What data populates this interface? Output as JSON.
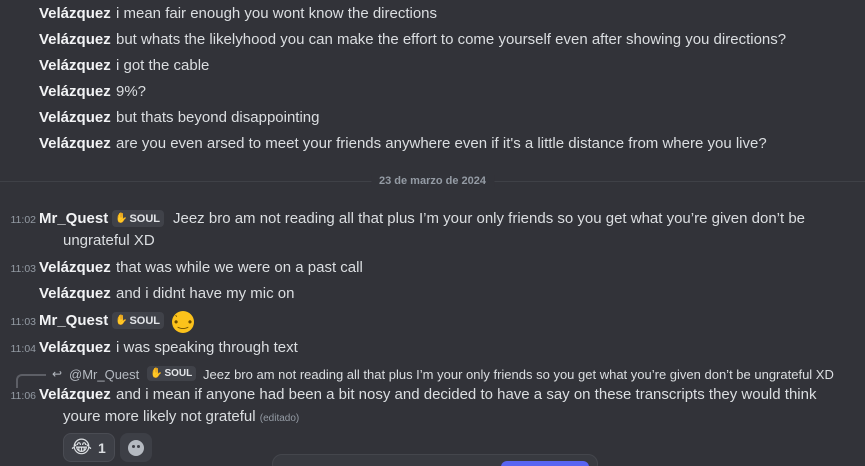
{
  "messages_top": [
    {
      "author": "Velázquez",
      "text": "i mean fair enough you wont know the directions"
    },
    {
      "author": "Velázquez",
      "text": "but whats the likelyhood you can make the effort to come yourself even after showing you directions?"
    },
    {
      "author": "Velázquez",
      "text": "i got the cable"
    },
    {
      "author": "Velázquez",
      "text": "9%?"
    },
    {
      "author": "Velázquez",
      "text": "but thats beyond disappointing"
    },
    {
      "author": "Velázquez",
      "text": "are you even arsed to meet your friends anywhere even if it's a little distance from where you live?"
    }
  ],
  "date_divider": "23 de marzo de 2024",
  "msg1": {
    "time": "11:02",
    "author": "Mr_Quest",
    "badge": "SOUL",
    "text_line1": "Jeez bro am not reading all that plus I’m your only friends so you get what you’re given don’t be",
    "text_line2": "ungrateful XD"
  },
  "msg2": {
    "time": "11:03",
    "author": "Velázquez",
    "text": "that was while we were on a past call"
  },
  "msg3": {
    "author": "Velázquez",
    "text": "and i didnt have my mic on"
  },
  "msg4": {
    "time": "11:03",
    "author": "Mr_Quest",
    "badge": "SOUL",
    "emoji": "confused-face"
  },
  "msg5": {
    "time": "11:04",
    "author": "Velázquez",
    "text": "i was speaking through text"
  },
  "reply": {
    "author": "@Mr_Quest",
    "badge": "SOUL",
    "text": "Jeez bro am not reading all that plus I’m your only friends so you get what you’re given don’t be ungrateful XD"
  },
  "msg6": {
    "time": "11:06",
    "author": "Velázquez",
    "text_line1": "and i mean if anyone had been a bit nosy and decided to have a say on these transcripts they would think",
    "text_line2": "youre more likely not grateful",
    "edited": "(editado)"
  },
  "reaction": {
    "emoji": "😂",
    "count": "1"
  },
  "colors": {
    "background": "#323339",
    "text": "#dbdee1",
    "author": "#f2f3f5",
    "muted": "#949ba4",
    "accent": "#5865f2"
  }
}
